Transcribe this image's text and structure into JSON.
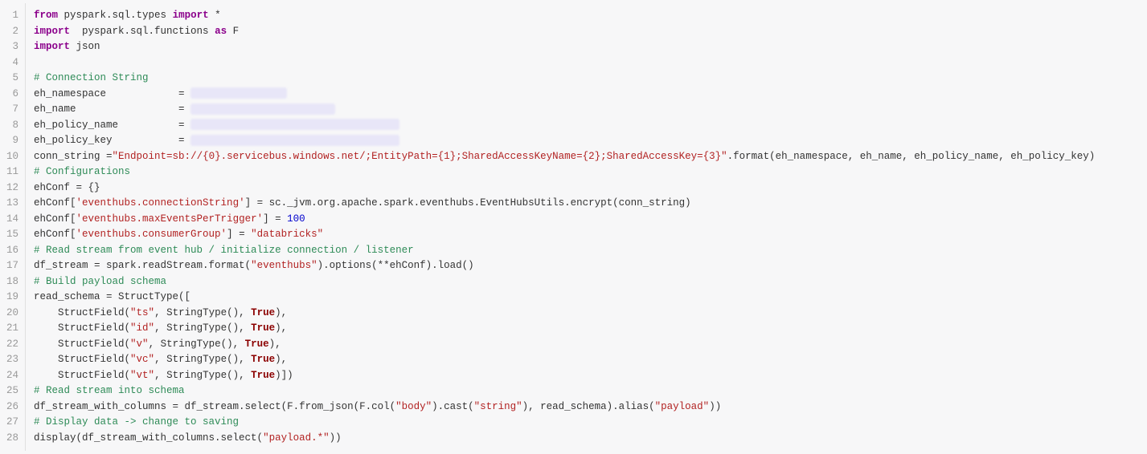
{
  "code": {
    "lines": [
      {
        "n": 1,
        "tokens": [
          [
            "kw",
            "from"
          ],
          [
            "",
            " pyspark.sql.types "
          ],
          [
            "kw",
            "import"
          ],
          [
            "",
            " *"
          ]
        ]
      },
      {
        "n": 2,
        "tokens": [
          [
            "kw",
            "import"
          ],
          [
            "",
            "  pyspark.sql.functions "
          ],
          [
            "kw",
            "as"
          ],
          [
            "",
            " F"
          ]
        ]
      },
      {
        "n": 3,
        "tokens": [
          [
            "kw",
            "import"
          ],
          [
            "",
            " json"
          ]
        ]
      },
      {
        "n": 4,
        "tokens": [
          [
            "",
            ""
          ]
        ]
      },
      {
        "n": 5,
        "tokens": [
          [
            "cmt",
            "# Connection String"
          ]
        ]
      },
      {
        "n": 6,
        "tokens": [
          [
            "",
            "eh_namespace            = "
          ],
          [
            "redact",
            "w120"
          ]
        ]
      },
      {
        "n": 7,
        "tokens": [
          [
            "",
            "eh_name                 = "
          ],
          [
            "redact",
            "w180"
          ]
        ]
      },
      {
        "n": 8,
        "tokens": [
          [
            "",
            "eh_policy_name          = "
          ],
          [
            "redact",
            "w260"
          ]
        ]
      },
      {
        "n": 9,
        "tokens": [
          [
            "",
            "eh_policy_key           = "
          ],
          [
            "redact",
            "w260"
          ]
        ]
      },
      {
        "n": 10,
        "tokens": [
          [
            "",
            "conn_string ="
          ],
          [
            "str",
            "\"Endpoint=sb://{0}.servicebus.windows.net/;EntityPath={1};SharedAccessKeyName={2};SharedAccessKey={3}\""
          ],
          [
            "",
            ".format(eh_namespace, eh_name, eh_policy_name, eh_policy_key)"
          ]
        ]
      },
      {
        "n": 11,
        "tokens": [
          [
            "cmt",
            "# Configurations"
          ]
        ]
      },
      {
        "n": 12,
        "tokens": [
          [
            "",
            "ehConf = {}"
          ]
        ]
      },
      {
        "n": 13,
        "tokens": [
          [
            "",
            "ehConf["
          ],
          [
            "str",
            "'eventhubs.connectionString'"
          ],
          [
            "",
            "] = sc._jvm.org.apache.spark.eventhubs.EventHubsUtils.encrypt(conn_string)"
          ]
        ]
      },
      {
        "n": 14,
        "tokens": [
          [
            "",
            "ehConf["
          ],
          [
            "str",
            "'eventhubs.maxEventsPerTrigger'"
          ],
          [
            "",
            "] = "
          ],
          [
            "num",
            "100"
          ]
        ]
      },
      {
        "n": 15,
        "tokens": [
          [
            "",
            "ehConf["
          ],
          [
            "str",
            "'eventhubs.consumerGroup'"
          ],
          [
            "",
            "] = "
          ],
          [
            "str",
            "\"databricks\""
          ]
        ]
      },
      {
        "n": 16,
        "tokens": [
          [
            "cmt",
            "# Read stream from event hub / initialize connection / listener"
          ]
        ]
      },
      {
        "n": 17,
        "tokens": [
          [
            "",
            "df_stream = spark.readStream.format("
          ],
          [
            "str",
            "\"eventhubs\""
          ],
          [
            "",
            ").options(**ehConf).load()"
          ]
        ]
      },
      {
        "n": 18,
        "tokens": [
          [
            "cmt",
            "# Build payload schema"
          ]
        ]
      },
      {
        "n": 19,
        "tokens": [
          [
            "",
            "read_schema = StructType(["
          ]
        ]
      },
      {
        "n": 20,
        "tokens": [
          [
            "",
            "    StructField("
          ],
          [
            "str",
            "\"ts\""
          ],
          [
            "",
            ", StringType(), "
          ],
          [
            "bool",
            "True"
          ],
          [
            "",
            "),"
          ]
        ]
      },
      {
        "n": 21,
        "tokens": [
          [
            "",
            "    StructField("
          ],
          [
            "str",
            "\"id\""
          ],
          [
            "",
            ", StringType(), "
          ],
          [
            "bool",
            "True"
          ],
          [
            "",
            "),"
          ]
        ]
      },
      {
        "n": 22,
        "tokens": [
          [
            "",
            "    StructField("
          ],
          [
            "str",
            "\"v\""
          ],
          [
            "",
            ", StringType(), "
          ],
          [
            "bool",
            "True"
          ],
          [
            "",
            "),"
          ]
        ]
      },
      {
        "n": 23,
        "tokens": [
          [
            "",
            "    StructField("
          ],
          [
            "str",
            "\"vc\""
          ],
          [
            "",
            ", StringType(), "
          ],
          [
            "bool",
            "True"
          ],
          [
            "",
            "),"
          ]
        ]
      },
      {
        "n": 24,
        "tokens": [
          [
            "",
            "    StructField("
          ],
          [
            "str",
            "\"vt\""
          ],
          [
            "",
            ", StringType(), "
          ],
          [
            "bool",
            "True"
          ],
          [
            "",
            ")])"
          ]
        ]
      },
      {
        "n": 25,
        "tokens": [
          [
            "cmt",
            "# Read stream into schema"
          ]
        ]
      },
      {
        "n": 26,
        "tokens": [
          [
            "",
            "df_stream_with_columns = df_stream.select(F.from_json(F.col("
          ],
          [
            "str",
            "\"body\""
          ],
          [
            "",
            ").cast("
          ],
          [
            "str",
            "\"string\""
          ],
          [
            "",
            "), read_schema).alias("
          ],
          [
            "str",
            "\"payload\""
          ],
          [
            "",
            "))"
          ]
        ]
      },
      {
        "n": 27,
        "tokens": [
          [
            "cmt",
            "# Display data -> change to saving"
          ]
        ]
      },
      {
        "n": 28,
        "tokens": [
          [
            "",
            "display(df_stream_with_columns.select("
          ],
          [
            "str",
            "\"payload.*\""
          ],
          [
            "",
            "))"
          ]
        ]
      }
    ]
  }
}
